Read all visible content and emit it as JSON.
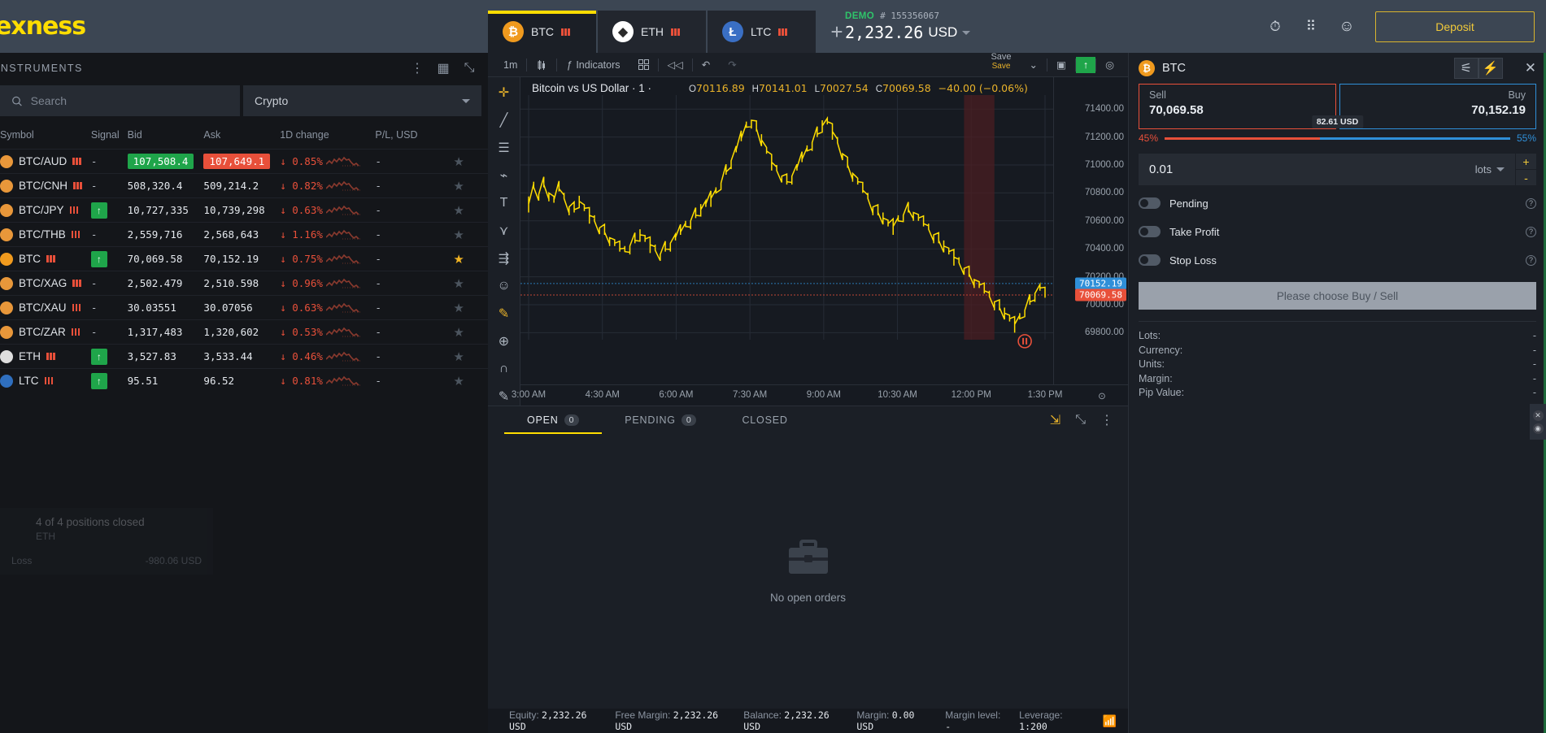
{
  "brand": {
    "name": "exness"
  },
  "left_panel": {
    "title": "INSTRUMENTS",
    "icons": [
      {
        "name": "more-vertical-icon",
        "glyph": "⋮"
      },
      {
        "name": "grid-view-icon",
        "glyph": "▦"
      },
      {
        "name": "collapse-icon",
        "glyph": "⤡"
      }
    ],
    "search": {
      "placeholder": "Search",
      "value": "",
      "icon": "search-icon"
    },
    "filter": {
      "value": "Crypto"
    },
    "columns": [
      "Symbol",
      "Signal",
      "Bid",
      "Ask",
      "1D change",
      "P/L, USD"
    ],
    "rows": [
      {
        "symbol": "BTC/AUD",
        "signal": "-",
        "bid": "107,508.4",
        "ask": "107,649.1",
        "change": "0.85%",
        "pl": "-",
        "favorite": false,
        "highlight": true,
        "coin_color": "#e8973a"
      },
      {
        "symbol": "BTC/CNH",
        "signal": "-",
        "bid": "508,320.4",
        "ask": "509,214.2",
        "change": "0.82%",
        "pl": "-",
        "favorite": false,
        "highlight": false,
        "coin_color": "#e8973a"
      },
      {
        "symbol": "BTC/JPY",
        "signal": "up",
        "bid": "10,727,335",
        "ask": "10,739,298",
        "change": "0.63%",
        "pl": "-",
        "favorite": false,
        "highlight": false,
        "coin_color": "#e8973a"
      },
      {
        "symbol": "BTC/THB",
        "signal": "-",
        "bid": "2,559,716",
        "ask": "2,568,643",
        "change": "1.16%",
        "pl": "-",
        "favorite": false,
        "highlight": false,
        "coin_color": "#e8973a"
      },
      {
        "symbol": "BTC",
        "signal": "up",
        "bid": "70,069.58",
        "ask": "70,152.19",
        "change": "0.75%",
        "pl": "-",
        "favorite": true,
        "highlight": false,
        "coin_color": "#f09a1e"
      },
      {
        "symbol": "BTC/XAG",
        "signal": "-",
        "bid": "2,502.479",
        "ask": "2,510.598",
        "change": "0.96%",
        "pl": "-",
        "favorite": false,
        "highlight": false,
        "coin_color": "#e8973a"
      },
      {
        "symbol": "BTC/XAU",
        "signal": "-",
        "bid": "30.03551",
        "ask": "30.07056",
        "change": "0.63%",
        "pl": "-",
        "favorite": false,
        "highlight": false,
        "coin_color": "#e8973a"
      },
      {
        "symbol": "BTC/ZAR",
        "signal": "-",
        "bid": "1,317,483",
        "ask": "1,320,602",
        "change": "0.53%",
        "pl": "-",
        "favorite": false,
        "highlight": false,
        "coin_color": "#e8973a"
      },
      {
        "symbol": "ETH",
        "signal": "up",
        "bid": "3,527.83",
        "ask": "3,533.44",
        "change": "0.46%",
        "pl": "-",
        "favorite": false,
        "highlight": false,
        "coin_color": "#dedede"
      },
      {
        "symbol": "LTC",
        "signal": "up",
        "bid": "95.51",
        "ask": "96.52",
        "change": "0.81%",
        "pl": "-",
        "favorite": false,
        "highlight": false,
        "coin_color": "#2f6fbf"
      }
    ],
    "toast": {
      "title": "4 of 4 positions closed",
      "subtitle": "ETH",
      "label": "Loss",
      "value": "-980.06 USD"
    }
  },
  "tabs": [
    {
      "label": "BTC",
      "icon": "bitcoin-icon",
      "color": "#f09a1e",
      "glyph": "Ƀ",
      "active": true
    },
    {
      "label": "ETH",
      "icon": "ethereum-icon",
      "color": "#ffffff",
      "glyph": "◆",
      "active": false
    },
    {
      "label": "LTC",
      "icon": "litecoin-icon",
      "color": "#3a6fc4",
      "glyph": "Ł",
      "active": false
    }
  ],
  "add_tab": {
    "label": "+"
  },
  "account": {
    "type": "DEMO",
    "number": "# 155356067",
    "balance": "2,232.26",
    "currency": "USD",
    "deposit_label": "Deposit"
  },
  "top_icons": [
    {
      "name": "alarm-clock-icon",
      "glyph": "⏰"
    },
    {
      "name": "apps-grid-icon",
      "glyph": "⠿"
    },
    {
      "name": "user-account-icon",
      "glyph": "◉"
    }
  ],
  "chart_toolbar": {
    "timeframe": "1m",
    "chart_type_icon": "candlestick-icon",
    "indicators_label": "Indicators",
    "layout_icon": "layout-grid-icon",
    "replay_icon": "replay-icon",
    "undo_icon": "undo-icon",
    "redo_icon": "redo-icon",
    "save_label": "Save",
    "save_sub": "Save",
    "camera_icon": "camera-icon",
    "publish_icon": "publish-arrow-icon",
    "eye_icon": "eye-icon"
  },
  "drawing_tools": [
    {
      "name": "crosshair-tool",
      "glyph": "✛"
    },
    {
      "name": "trend-line-tool",
      "glyph": "╱"
    },
    {
      "name": "horizontal-lines-tool",
      "glyph": "☰"
    },
    {
      "name": "pitchfork-tool",
      "glyph": "⌁"
    },
    {
      "name": "text-tool",
      "glyph": "T"
    },
    {
      "name": "pattern-tool",
      "glyph": "⋎"
    },
    {
      "name": "measure-tool",
      "glyph": "⇶"
    },
    {
      "name": "emoji-tool",
      "glyph": "☺"
    },
    {
      "name": "ruler-tool",
      "glyph": "📏"
    },
    {
      "name": "zoom-tool",
      "glyph": "⊕"
    },
    {
      "name": "magnet-tool",
      "glyph": "∩"
    },
    {
      "name": "pen-tool",
      "glyph": "✎"
    }
  ],
  "chart_data": {
    "type": "line",
    "title": "Bitcoin vs US Dollar · 1 ·",
    "ohlc": {
      "o_label": "O",
      "o": "70116.89",
      "h_label": "H",
      "h": "70141.01",
      "l_label": "L",
      "l": "70027.54",
      "c_label": "C",
      "c": "70069.58",
      "change": "−40.00 (−0.06%)"
    },
    "ylabel": "",
    "xlabel": "",
    "ylim": [
      69750,
      71500
    ],
    "yticks": [
      "71400.00",
      "71200.00",
      "71000.00",
      "70800.00",
      "70600.00",
      "70400.00",
      "70200.00",
      "70000.00",
      "69800.00"
    ],
    "xticks": [
      "3:00 AM",
      "4:30 AM",
      "6:00 AM",
      "7:30 AM",
      "9:00 AM",
      "10:30 AM",
      "12:00 PM",
      "1:30 PM"
    ],
    "price_labels": [
      {
        "value": "70152.19",
        "color": "#2f8fd8"
      },
      {
        "value": "70069.58",
        "color": "#e8503a"
      }
    ],
    "series": [
      {
        "name": "BTC/USD",
        "color": "#ffdd00",
        "values": [
          70720,
          70840,
          70790,
          70860,
          70800,
          70750,
          70830,
          70760,
          70700,
          70680,
          70740,
          70690,
          70640,
          70600,
          70550,
          70520,
          70480,
          70440,
          70400,
          70380,
          70420,
          70460,
          70500,
          70470,
          70430,
          70390,
          70360,
          70400,
          70440,
          70480,
          70520,
          70560,
          70600,
          70640,
          70680,
          70720,
          70760,
          70800,
          70870,
          70950,
          71030,
          71110,
          71190,
          71270,
          71320,
          71260,
          71180,
          71100,
          71020,
          70960,
          70920,
          70880,
          70920,
          70980,
          71040,
          71100,
          71160,
          71220,
          71280,
          71310,
          71240,
          71160,
          71080,
          71000,
          70940,
          70880,
          70820,
          70760,
          70700,
          70660,
          70620,
          70580,
          70560,
          70600,
          70640,
          70680,
          70660,
          70620,
          70580,
          70540,
          70500,
          70460,
          70420,
          70380,
          70340,
          70300,
          70260,
          70220,
          70180,
          70140,
          70100,
          70060,
          70020,
          69980,
          69940,
          69900,
          69860,
          69900,
          69960,
          70020,
          70080,
          70120,
          70070
        ]
      }
    ],
    "session_highlight": {
      "from_index": 86,
      "to_index": 92
    },
    "marker_icon": "pause-marker-icon",
    "grid": true
  },
  "bottom_tabs": [
    {
      "label": "OPEN",
      "count": "0",
      "active": true
    },
    {
      "label": "PENDING",
      "count": "0",
      "active": false
    },
    {
      "label": "CLOSED",
      "count": null,
      "active": false
    }
  ],
  "bottom_tab_icons": [
    {
      "name": "export-icon",
      "glyph": "⇲"
    },
    {
      "name": "collapse-panel-icon",
      "glyph": "⤡"
    },
    {
      "name": "more-vertical-icon",
      "glyph": "⋮"
    }
  ],
  "orders": {
    "empty_text": "No open orders",
    "icon": "briefcase-icon"
  },
  "status_bar": [
    {
      "label": "Equity:",
      "value": "2,232.26 USD"
    },
    {
      "label": "Free Margin:",
      "value": "2,232.26 USD"
    },
    {
      "label": "Balance:",
      "value": "2,232.26 USD"
    },
    {
      "label": "Margin:",
      "value": "0.00 USD"
    },
    {
      "label": "Margin level:",
      "value": "-"
    },
    {
      "label": "Leverage:",
      "value": "1:200"
    }
  ],
  "connection_icon": "signal-icon",
  "trade_panel": {
    "symbol": "BTC",
    "settings_icon": "sliders-icon",
    "oneclick_icon": "one-click-trade-icon",
    "close_icon": "close-icon",
    "sell": {
      "label": "Sell",
      "price": "70,069.58"
    },
    "buy": {
      "label": "Buy",
      "price": "70,152.19"
    },
    "spread": "82.61 USD",
    "sell_pct": "45%",
    "buy_pct": "55%",
    "volume": {
      "value": "0.01",
      "unit": "lots",
      "plus": "+",
      "minus": "-"
    },
    "toggles": [
      {
        "label": "Pending",
        "on": false
      },
      {
        "label": "Take Profit",
        "on": false
      },
      {
        "label": "Stop Loss",
        "on": false
      }
    ],
    "cta": "Please choose Buy / Sell",
    "details": [
      {
        "label": "Lots:",
        "value": "-"
      },
      {
        "label": "Currency:",
        "value": "-"
      },
      {
        "label": "Units:",
        "value": "-"
      },
      {
        "label": "Margin:",
        "value": "-"
      },
      {
        "label": "Pip Value:",
        "value": "-"
      }
    ]
  },
  "side_dock": [
    {
      "name": "close-dock-icon",
      "glyph": "✕"
    },
    {
      "name": "chat-dock-icon",
      "glyph": "◉"
    }
  ]
}
